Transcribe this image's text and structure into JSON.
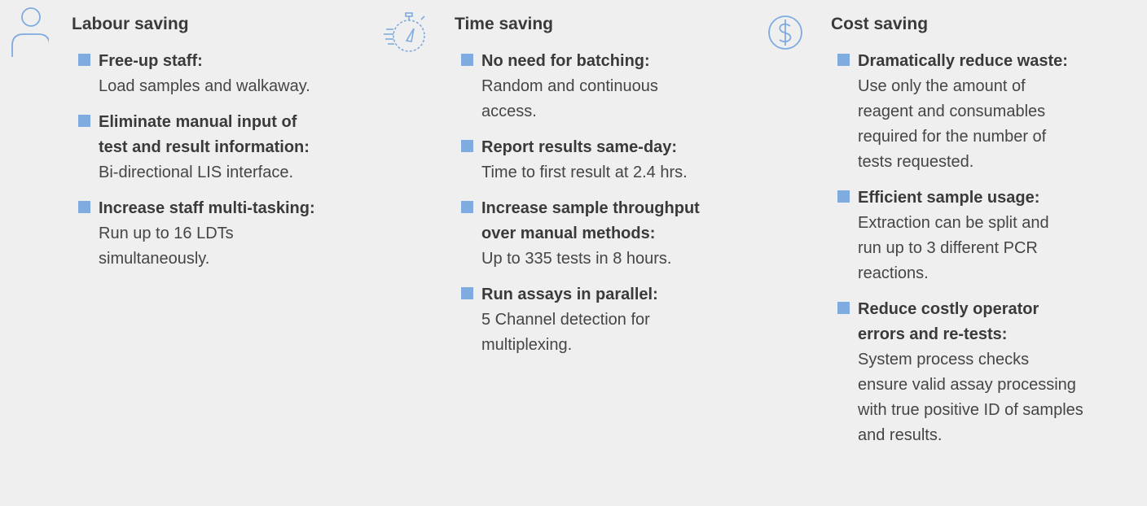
{
  "colors": {
    "background": "#efeff0",
    "accent": "#7fabe0",
    "icon_stroke": "#7fabe0",
    "text": "#3c3c3c"
  },
  "columns": [
    {
      "icon": "person-icon",
      "heading": "Labour saving",
      "items": [
        {
          "title": "Free-up staff:",
          "body": "Load samples and walkaway."
        },
        {
          "title": "Eliminate manual input of\ntest and result information:",
          "body": "Bi-directional LIS interface."
        },
        {
          "title": "Increase staff multi-tasking:",
          "body": "Run up to 16 LDTs\nsimultaneously."
        }
      ]
    },
    {
      "icon": "stopwatch-icon",
      "heading": "Time saving",
      "items": [
        {
          "title": "No need for batching:",
          "body": "Random and continuous\naccess."
        },
        {
          "title": "Report results same-day:",
          "body": "Time to first result at 2.4 hrs."
        },
        {
          "title": "Increase sample throughput\nover manual methods:",
          "body": "Up to 335 tests in 8 hours."
        },
        {
          "title": "Run assays in parallel:",
          "body": "5 Channel detection for\nmultiplexing."
        }
      ]
    },
    {
      "icon": "dollar-coin-icon",
      "heading": "Cost saving",
      "items": [
        {
          "title": "Dramatically reduce waste:",
          "body": "Use only the amount of\nreagent and consumables\nrequired for the number of\ntests requested."
        },
        {
          "title": "Efficient sample usage:",
          "body": "Extraction can be split and\nrun up to 3 different PCR\nreactions."
        },
        {
          "title": "Reduce costly operator\nerrors and re-tests:",
          "body": "System process checks\nensure valid assay processing\nwith true positive ID of samples\nand results."
        }
      ]
    }
  ]
}
